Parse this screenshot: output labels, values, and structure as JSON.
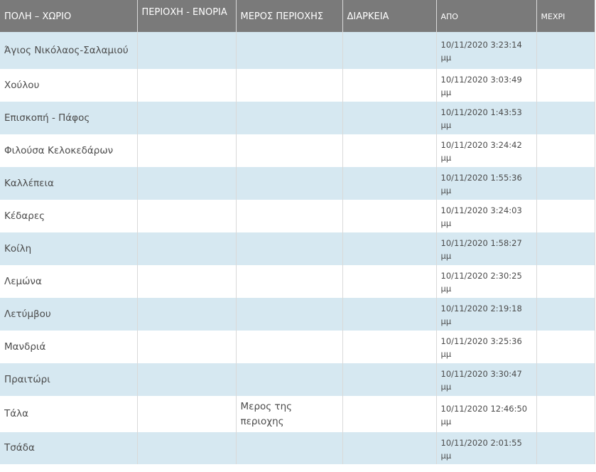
{
  "columns": {
    "city": "ΠΟΛΗ – ΧΩΡΙΟ",
    "area": "ΠΕΡΙΟΧΗ - ΕΝΟΡΙΑ",
    "part": "ΜΕΡΟΣ ΠΕΡΙΟΧΗΣ",
    "duration": "ΔΙΑΡΚΕΙΑ",
    "from": "ΑΠΟ",
    "to": "ΜΕΧΡΙ"
  },
  "rows": [
    {
      "city": "Άγιος Νικόλαος-Σαλαμιού",
      "area": "",
      "part": "",
      "duration": "",
      "from": "10/11/2020 3:23:14 μμ",
      "to": ""
    },
    {
      "city": "Χούλου",
      "area": "",
      "part": "",
      "duration": "",
      "from": "10/11/2020 3:03:49 μμ",
      "to": ""
    },
    {
      "city": "Επισκοπή - Πάφος",
      "area": "",
      "part": "",
      "duration": "",
      "from": "10/11/2020 1:43:53 μμ",
      "to": ""
    },
    {
      "city": "Φιλούσα Κελοκεδάρων",
      "area": "",
      "part": "",
      "duration": "",
      "from": "10/11/2020 3:24:42 μμ",
      "to": ""
    },
    {
      "city": "Καλλέπεια",
      "area": "",
      "part": "",
      "duration": "",
      "from": "10/11/2020 1:55:36 μμ",
      "to": ""
    },
    {
      "city": "Κέδαρες",
      "area": "",
      "part": "",
      "duration": "",
      "from": "10/11/2020 3:24:03 μμ",
      "to": ""
    },
    {
      "city": "Κοίλη",
      "area": "",
      "part": "",
      "duration": "",
      "from": "10/11/2020 1:58:27 μμ",
      "to": ""
    },
    {
      "city": "Λεμώνα",
      "area": "",
      "part": "",
      "duration": "",
      "from": "10/11/2020 2:30:25 μμ",
      "to": ""
    },
    {
      "city": "Λετύμβου",
      "area": "",
      "part": "",
      "duration": "",
      "from": "10/11/2020 2:19:18 μμ",
      "to": ""
    },
    {
      "city": "Μανδριά",
      "area": "",
      "part": "",
      "duration": "",
      "from": "10/11/2020 3:25:36 μμ",
      "to": ""
    },
    {
      "city": "Πραιτώρι",
      "area": "",
      "part": "",
      "duration": "",
      "from": "10/11/2020 3:30:47 μμ",
      "to": ""
    },
    {
      "city": "Τάλα",
      "area": "",
      "part": "Μερος της περιοχης",
      "duration": "",
      "from": "10/11/2020 12:46:50 μμ",
      "to": ""
    },
    {
      "city": "Τσάδα",
      "area": "",
      "part": "",
      "duration": "",
      "from": "10/11/2020 2:01:55 μμ",
      "to": ""
    }
  ]
}
